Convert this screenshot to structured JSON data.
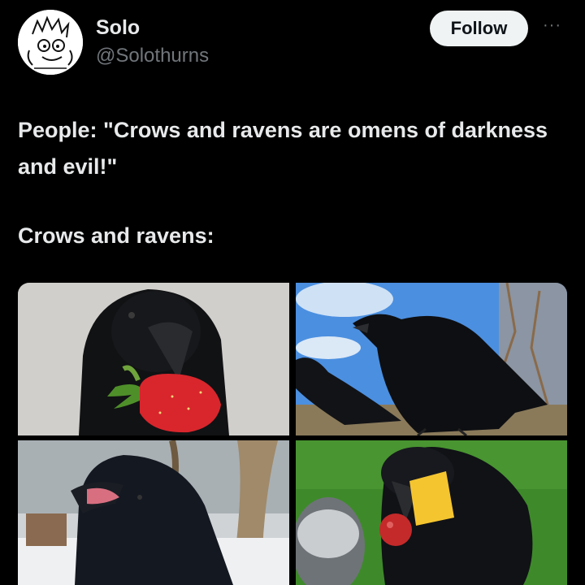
{
  "author": {
    "name": "Solo",
    "handle": "@Solothurns",
    "avatar_icon": "avatar-sketch-icon"
  },
  "actions": {
    "follow_label": "Follow",
    "more_label": "···"
  },
  "tweet": {
    "line1": "People: \"Crows and ravens are omens of darkness and evil!\"",
    "line2": "Crows and ravens:"
  },
  "media": [
    {
      "name": "crow-with-strawberry-photo",
      "icon": "crow-strawberry-image"
    },
    {
      "name": "crow-with-blue-sky-photo",
      "icon": "crow-sky-image"
    },
    {
      "name": "raven-in-snow-photo",
      "icon": "raven-snow-image"
    },
    {
      "name": "crow-with-fruit-on-grass-photo",
      "icon": "crow-grass-image"
    }
  ],
  "colors": {
    "background": "#000000",
    "text": "#e7e9ea",
    "secondary_text": "#71767b",
    "follow_bg": "#eff3f4"
  }
}
